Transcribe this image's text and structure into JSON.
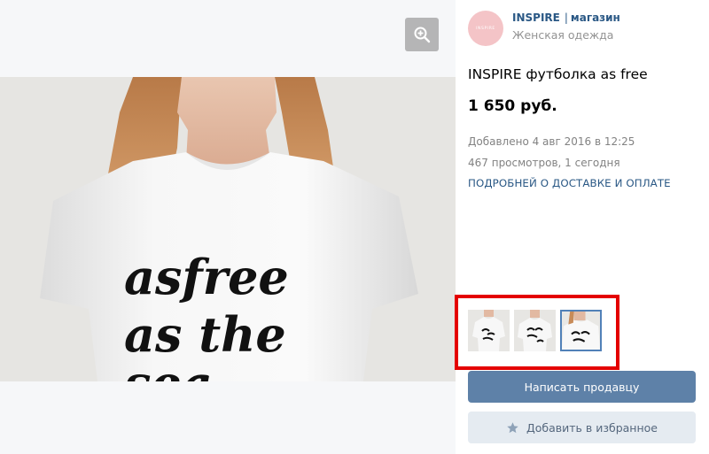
{
  "photo": {
    "zoom_icon": "zoom-in-icon",
    "print_line1": "asfree",
    "print_line2": "as the",
    "print_line3": "sea"
  },
  "shop": {
    "avatar_text": "INSPIRE",
    "name": "INSPIRE",
    "separator": "|",
    "name_suffix": "магазин",
    "subtitle": "Женская одежда"
  },
  "product": {
    "title": "INSPIRE футболка as free",
    "price": "1 650 руб.",
    "added": "Добавлено 4 авг 2016 в 12:25",
    "views": "467 просмотров, 1 сегодня",
    "delivery_link": "ПОДРОБНЕЙ О ДОСТАВКЕ И ОПЛАТЕ"
  },
  "thumbnails": {
    "count": 3,
    "active_index": 2
  },
  "buttons": {
    "contact_seller": "Написать продавцу",
    "add_favorite": "Добавить в избранное",
    "favorite_icon": "star-icon"
  },
  "colors": {
    "accent": "#5e81a8",
    "link": "#2a5885",
    "highlight": "#e40000",
    "avatar_bg": "#f4c4c7"
  }
}
